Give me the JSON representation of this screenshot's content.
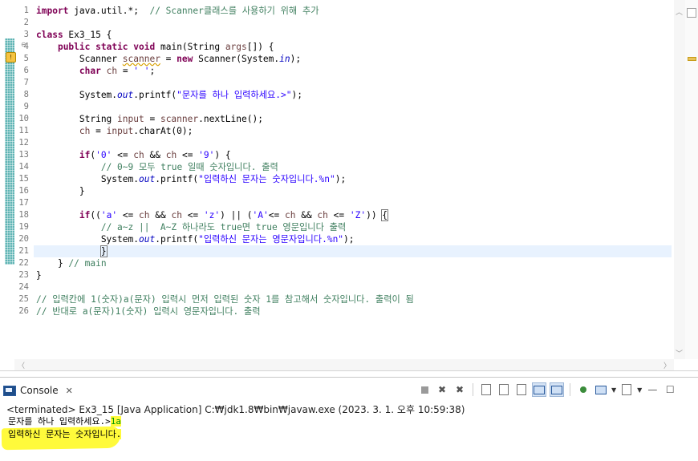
{
  "editor": {
    "line_numbers": [
      "1",
      "2",
      "3",
      "4",
      "5",
      "6",
      "7",
      "8",
      "9",
      "10",
      "11",
      "12",
      "13",
      "14",
      "15",
      "16",
      "17",
      "18",
      "19",
      "20",
      "21",
      "22",
      "23",
      "24",
      "25",
      "26"
    ],
    "lines": [
      [
        {
          "t": "import",
          "c": "kw"
        },
        {
          "t": " java.util.*;  ",
          "c": ""
        },
        {
          "t": "// Scanner클래스를 사용하기 위해 추가",
          "c": "cm"
        }
      ],
      [],
      [
        {
          "t": "class",
          "c": "kw"
        },
        {
          "t": " Ex3_15 {",
          "c": ""
        }
      ],
      [
        {
          "t": "    ",
          "c": ""
        },
        {
          "t": "public",
          "c": "kw"
        },
        {
          "t": " ",
          "c": ""
        },
        {
          "t": "static",
          "c": "kw"
        },
        {
          "t": " ",
          "c": ""
        },
        {
          "t": "void",
          "c": "kw"
        },
        {
          "t": " main(String ",
          "c": ""
        },
        {
          "t": "args",
          "c": "lv"
        },
        {
          "t": "[]) {",
          "c": ""
        }
      ],
      [
        {
          "t": "        Scanner ",
          "c": ""
        },
        {
          "t": "scanner",
          "c": "warn"
        },
        {
          "t": " = ",
          "c": ""
        },
        {
          "t": "new",
          "c": "kw"
        },
        {
          "t": " Scanner(System.",
          "c": ""
        },
        {
          "t": "in",
          "c": "fld"
        },
        {
          "t": ");",
          "c": ""
        }
      ],
      [
        {
          "t": "        ",
          "c": ""
        },
        {
          "t": "char",
          "c": "kw"
        },
        {
          "t": " ",
          "c": ""
        },
        {
          "t": "ch",
          "c": "lv"
        },
        {
          "t": " = ",
          "c": ""
        },
        {
          "t": "' '",
          "c": "str"
        },
        {
          "t": ";",
          "c": ""
        }
      ],
      [],
      [
        {
          "t": "        System.",
          "c": ""
        },
        {
          "t": "out",
          "c": "fld"
        },
        {
          "t": ".printf(",
          "c": ""
        },
        {
          "t": "\"문자를 하나 입력하세요.>\"",
          "c": "str"
        },
        {
          "t": ");",
          "c": ""
        }
      ],
      [],
      [
        {
          "t": "        String ",
          "c": ""
        },
        {
          "t": "input",
          "c": "lv"
        },
        {
          "t": " = ",
          "c": ""
        },
        {
          "t": "scanner",
          "c": "lv"
        },
        {
          "t": ".nextLine();",
          "c": ""
        }
      ],
      [
        {
          "t": "        ",
          "c": ""
        },
        {
          "t": "ch",
          "c": "lv"
        },
        {
          "t": " = ",
          "c": ""
        },
        {
          "t": "input",
          "c": "lv"
        },
        {
          "t": ".charAt(0);",
          "c": ""
        }
      ],
      [],
      [
        {
          "t": "        ",
          "c": ""
        },
        {
          "t": "if",
          "c": "kw"
        },
        {
          "t": "(",
          "c": ""
        },
        {
          "t": "'0'",
          "c": "str"
        },
        {
          "t": " <= ",
          "c": ""
        },
        {
          "t": "ch",
          "c": "lv"
        },
        {
          "t": " && ",
          "c": ""
        },
        {
          "t": "ch",
          "c": "lv"
        },
        {
          "t": " <= ",
          "c": ""
        },
        {
          "t": "'9'",
          "c": "str"
        },
        {
          "t": ") {",
          "c": ""
        }
      ],
      [
        {
          "t": "            ",
          "c": ""
        },
        {
          "t": "// 0~9 모두 true 일때 숫자입니다. 출력",
          "c": "cm"
        }
      ],
      [
        {
          "t": "            System.",
          "c": ""
        },
        {
          "t": "out",
          "c": "fld"
        },
        {
          "t": ".printf(",
          "c": ""
        },
        {
          "t": "\"입력하신 문자는 숫자입니다.%n\"",
          "c": "str"
        },
        {
          "t": ");",
          "c": ""
        }
      ],
      [
        {
          "t": "        }",
          "c": ""
        }
      ],
      [],
      [
        {
          "t": "        ",
          "c": ""
        },
        {
          "t": "if",
          "c": "kw"
        },
        {
          "t": "((",
          "c": ""
        },
        {
          "t": "'a'",
          "c": "str"
        },
        {
          "t": " <= ",
          "c": ""
        },
        {
          "t": "ch",
          "c": "lv"
        },
        {
          "t": " && ",
          "c": ""
        },
        {
          "t": "ch",
          "c": "lv"
        },
        {
          "t": " <= ",
          "c": ""
        },
        {
          "t": "'z'",
          "c": "str"
        },
        {
          "t": ") || (",
          "c": ""
        },
        {
          "t": "'A'",
          "c": "str"
        },
        {
          "t": "<= ",
          "c": ""
        },
        {
          "t": "ch",
          "c": "lv"
        },
        {
          "t": " && ",
          "c": ""
        },
        {
          "t": "ch",
          "c": "lv"
        },
        {
          "t": " <= ",
          "c": ""
        },
        {
          "t": "'Z'",
          "c": "str"
        },
        {
          "t": ")) ",
          "c": ""
        },
        {
          "t": "{",
          "c": "brace"
        }
      ],
      [
        {
          "t": "            ",
          "c": ""
        },
        {
          "t": "// a~z ||  A~Z 하나라도 true면 true 영문입니다 출력",
          "c": "cm"
        }
      ],
      [
        {
          "t": "            System.",
          "c": ""
        },
        {
          "t": "out",
          "c": "fld"
        },
        {
          "t": ".printf(",
          "c": ""
        },
        {
          "t": "\"입력하신 문자는 영문자입니다.%n\"",
          "c": "str"
        },
        {
          "t": ");",
          "c": ""
        }
      ],
      [
        {
          "t": "            ",
          "c": ""
        },
        {
          "t": "}",
          "c": "brace"
        },
        {
          "t": "",
          "c": "caret"
        }
      ],
      [
        {
          "t": "    } ",
          "c": ""
        },
        {
          "t": "// main",
          "c": "cm"
        }
      ],
      [
        {
          "t": "}",
          "c": ""
        }
      ],
      [],
      [
        {
          "t": "// 입력칸에 1(숫자)a(문자) 입력시 먼저 입력된 숫자 1를 참고해서 숫자입니다. 출력이 됨",
          "c": "cm"
        }
      ],
      [
        {
          "t": "// 반대로 a(문자)1(숫자) 입력시 영문자입니다. 출력",
          "c": "cm"
        }
      ]
    ],
    "current_line_index": 20
  },
  "console": {
    "tab_label": "Console",
    "header": "<terminated> Ex3_15 [Java Application] C:₩jdk1.8₩bin₩javaw.exe (2023. 3. 1. 오후 10:59:38)",
    "prompt": "문자를 하나 입력하세요.>",
    "user_input": "1a",
    "result": "입력하신 문자는 숫자입니다."
  },
  "colors": {
    "keyword": "#7f0055",
    "string": "#2a00ff",
    "comment": "#3f7f5f",
    "highlight": "#fffa3b",
    "current_line": "#e8f2fe"
  }
}
